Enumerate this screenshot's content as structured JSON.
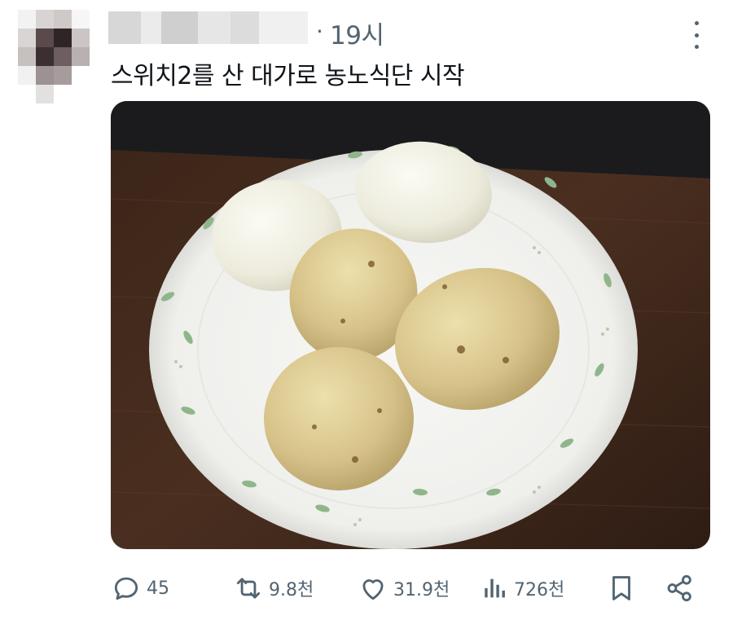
{
  "tweet": {
    "time": "19시",
    "separator": "·",
    "text": "스위치2를 산 대가로 농노식단 시작"
  },
  "media": {
    "subject": "boiled-eggs-and-potatoes-plate"
  },
  "actions": {
    "replies": "45",
    "retweets": "9.8천",
    "likes": "31.9천",
    "views": "726천"
  },
  "icons": [
    "more-icon",
    "reply-icon",
    "retweet-icon",
    "like-icon",
    "views-icon",
    "bookmark-icon",
    "share-icon"
  ],
  "colors": {
    "secondary_text": "#536471",
    "primary_text": "#0f1419"
  }
}
